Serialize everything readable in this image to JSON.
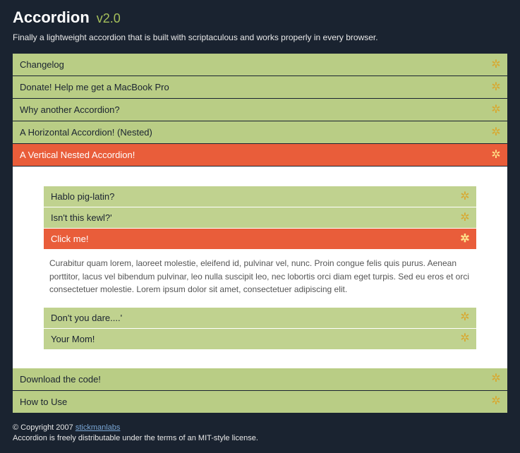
{
  "header": {
    "title": "Accordion",
    "version": "v2.0",
    "subtitle": "Finally a lightweight accordion that is built with scriptaculous and works properly in every browser."
  },
  "main_items": [
    {
      "label": "Changelog",
      "style": "green"
    },
    {
      "label": "Donate! Help me get a MacBook Pro",
      "style": "green"
    },
    {
      "label": "Why another Accordion?",
      "style": "green"
    },
    {
      "label": "A Horizontal Accordion! (Nested)",
      "style": "green"
    },
    {
      "label": "A Vertical Nested Accordion!",
      "style": "orange"
    }
  ],
  "nested_items_top": [
    {
      "label": "Hablo pig-latin?",
      "style": "green"
    },
    {
      "label": "Isn't this kewl?'",
      "style": "green"
    },
    {
      "label": "Click me!",
      "style": "orange"
    }
  ],
  "nested_content": "Curabitur quam lorem, laoreet molestie, eleifend id, pulvinar vel, nunc. Proin congue felis quis purus. Aenean porttitor, lacus vel bibendum pulvinar, leo nulla suscipit leo, nec lobortis orci diam eget turpis. Sed eu eros et orci consectetuer molestie. Lorem ipsum dolor sit amet, consectetuer adipiscing elit.",
  "nested_items_bottom": [
    {
      "label": "Don't you dare....'",
      "style": "green"
    },
    {
      "label": "Your Mom!",
      "style": "green"
    }
  ],
  "main_items_bottom": [
    {
      "label": "Download the code!",
      "style": "green"
    },
    {
      "label": "How to Use",
      "style": "green"
    }
  ],
  "footer": {
    "copyright": "© Copyright 2007 ",
    "link_text": "stickmanlabs",
    "license": "Accordion is freely distributable under the terms of an MIT-style license."
  },
  "icon_glyph": "✲"
}
